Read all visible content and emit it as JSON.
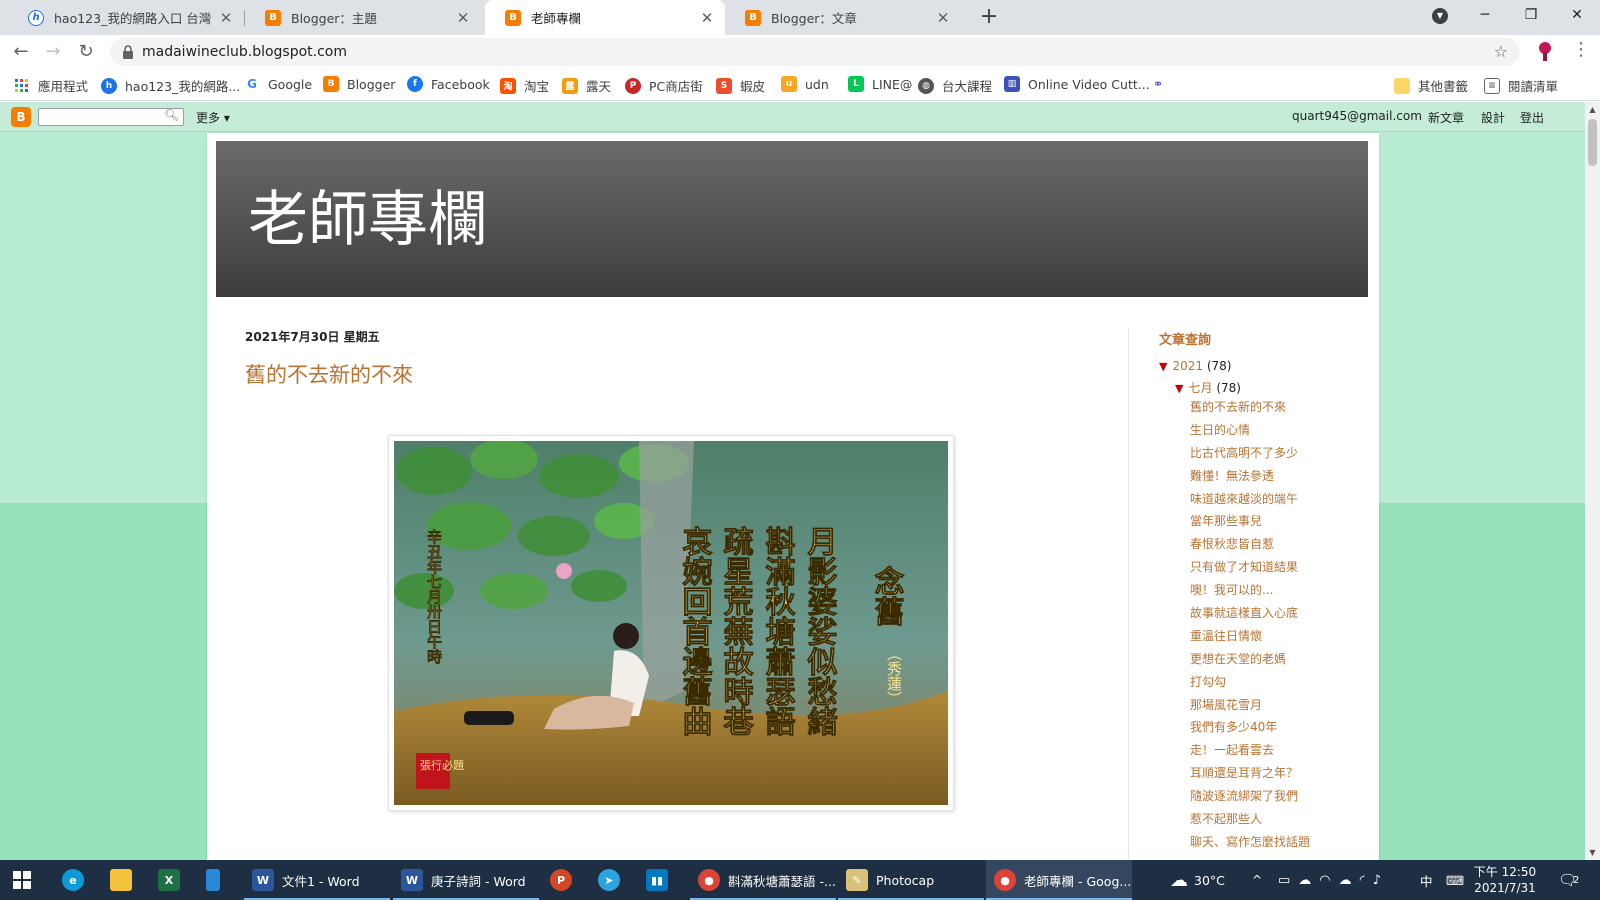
{
  "browser": {
    "tabs": [
      {
        "title": "hao123_我的網路入口 台灣",
        "icon": "hao123-icon",
        "active": false
      },
      {
        "title": "Blogger：主題",
        "icon": "blogger-icon",
        "active": false
      },
      {
        "title": "老師專欄",
        "icon": "blogger-icon",
        "active": true
      },
      {
        "title": "Blogger：文章",
        "icon": "blogger-icon",
        "active": false
      }
    ],
    "new_tab_symbol": "+",
    "url": "madaiwineclub.blogspot.com",
    "bookmarks": [
      {
        "label": "應用程式"
      },
      {
        "label": "hao123_我的網路..."
      },
      {
        "label": "Google"
      },
      {
        "label": "Blogger"
      },
      {
        "label": "Facebook"
      },
      {
        "label": "淘宝"
      },
      {
        "label": "露天"
      },
      {
        "label": "PC商店街"
      },
      {
        "label": "蝦皮"
      },
      {
        "label": "udn"
      },
      {
        "label": "LINE@"
      },
      {
        "label": "台大課程"
      },
      {
        "label": "Online Video Cutt..."
      }
    ],
    "other_bookmarks": "其他書籤",
    "reading_list": "閱讀清單"
  },
  "blogger_navbar": {
    "logo": "B",
    "more": "更多 ▾",
    "email": "quart945@gmail.com",
    "new_post": "新文章",
    "design": "設計",
    "sign_out": "登出"
  },
  "blog": {
    "title": "老師專欄",
    "post_date": "2021年7月30日 星期五",
    "post_title": "舊的不去新的不來",
    "poem": {
      "title": "念舊",
      "author": "（秀蓮）",
      "columns": [
        "月影婆娑似愁緒",
        "斟滿秋塘蕭瑟語",
        "疏星荒蕪故時巷",
        "哀婉回首邊舊曲"
      ],
      "date_line": "辛丑年七月卅日午時",
      "seal": "張行必題"
    }
  },
  "sidebar": {
    "archive_title": "文章查詢",
    "year": "2021",
    "year_count": "(78)",
    "month": "七月",
    "month_count": "(78)",
    "posts": [
      "舊的不去新的不來",
      "生日的心情",
      "比古代高明不了多少",
      "難懂！無法參透",
      "味道越來越淡的端午",
      "當年那些事兒",
      "春恨秋悲皆自惹",
      "只有做了才知道結果",
      "噢！我可以的...",
      "故事就這樣直入心底",
      "重溫往日情懷",
      "更想在天堂的老媽",
      "打勾勾",
      "那場風花雪月",
      "我們有多少40年",
      "走！一起看雲去",
      "耳順還是耳背之年？",
      "隨波逐流綁架了我們",
      "惹不起那些人",
      "聊天、寫作怎麼找話題"
    ]
  },
  "taskbar": {
    "items": [
      {
        "label": "文件1 - Word"
      },
      {
        "label": "庚子詩詞 - Word"
      },
      {
        "label": "斟滿秋塘蕭瑟語 -..."
      },
      {
        "label": "Photocap"
      },
      {
        "label": "老師專欄 - Goog..."
      }
    ],
    "temperature": "30°C",
    "ime": "中",
    "time": "下午 12:50",
    "date": "2021/7/31",
    "notifications": "2"
  },
  "colors": {
    "accent_link": "#b87333",
    "blogger_orange": "#f57d00",
    "page_bg": "#b8ecd2",
    "header_dark": "#4a4a4a",
    "taskbar": "#1f2f43"
  }
}
